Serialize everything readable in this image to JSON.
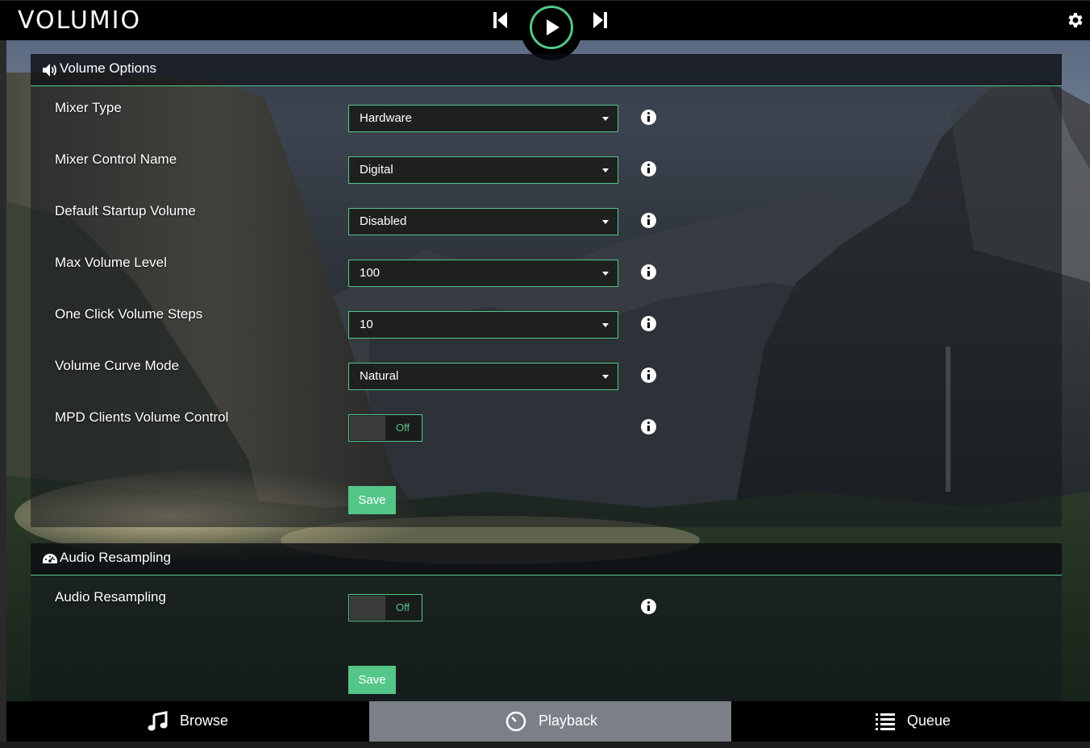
{
  "topbar": {
    "logo": "VOLUMIO"
  },
  "volume_options": {
    "title": "Volume Options",
    "rows": [
      {
        "label": "Mixer Type",
        "value": "Hardware"
      },
      {
        "label": "Mixer Control Name",
        "value": "Digital"
      },
      {
        "label": "Default Startup Volume",
        "value": "Disabled"
      },
      {
        "label": "Max Volume Level",
        "value": "100"
      },
      {
        "label": "One Click Volume Steps",
        "value": "10"
      },
      {
        "label": "Volume Curve Mode",
        "value": "Natural"
      }
    ],
    "mpd_label": "MPD Clients Volume Control",
    "mpd_toggle": "Off",
    "save_label": "Save"
  },
  "audio_resampling": {
    "title": "Audio Resampling",
    "row_label": "Audio Resampling",
    "toggle": "Off",
    "save_label": "Save"
  },
  "nav": {
    "browse": "Browse",
    "playback": "Playback",
    "queue": "Queue"
  },
  "colors": {
    "accent": "#54c688",
    "active_tab": "#7b8088"
  },
  "icons": {
    "prev": "skip-previous-icon",
    "play": "play-icon",
    "next": "skip-next-icon",
    "settings": "gear-icon",
    "volume": "volume-icon",
    "resampling": "dashboard-icon",
    "info": "info-icon",
    "browse": "music-note-icon",
    "playback": "clock-icon",
    "queue": "list-icon"
  }
}
